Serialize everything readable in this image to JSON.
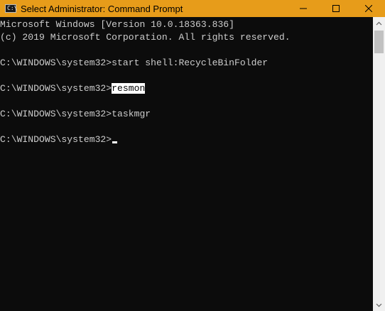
{
  "window": {
    "title": "Select Administrator: Command Prompt",
    "title_bar_color": "#e79c1a",
    "app_icon": "cmd-icon",
    "controls": [
      {
        "name": "minimize-button",
        "icon": "minimize-icon"
      },
      {
        "name": "maximize-button",
        "icon": "maximize-icon"
      },
      {
        "name": "close-button",
        "icon": "close-icon"
      }
    ]
  },
  "console": {
    "background_color": "#0c0c0c",
    "text_color": "#cccccc",
    "lines": {
      "version": "Microsoft Windows [Version 10.0.18363.836]",
      "copyright": "(c) 2019 Microsoft Corporation. All rights reserved.",
      "cmd1_prompt": "C:\\WINDOWS\\system32>",
      "cmd1_text": "start shell:RecycleBinFolder",
      "cmd2_prompt": "C:\\WINDOWS\\system32>",
      "cmd2_text": "resmon",
      "cmd3_prompt": "C:\\WINDOWS\\system32>",
      "cmd3_text": "taskmgr",
      "cmd4_prompt": "C:\\WINDOWS\\system32>"
    },
    "selected_text": "resmon"
  },
  "scrollbar": {
    "up_icon": "scroll-up-arrow-icon",
    "down_icon": "scroll-down-arrow-icon"
  }
}
